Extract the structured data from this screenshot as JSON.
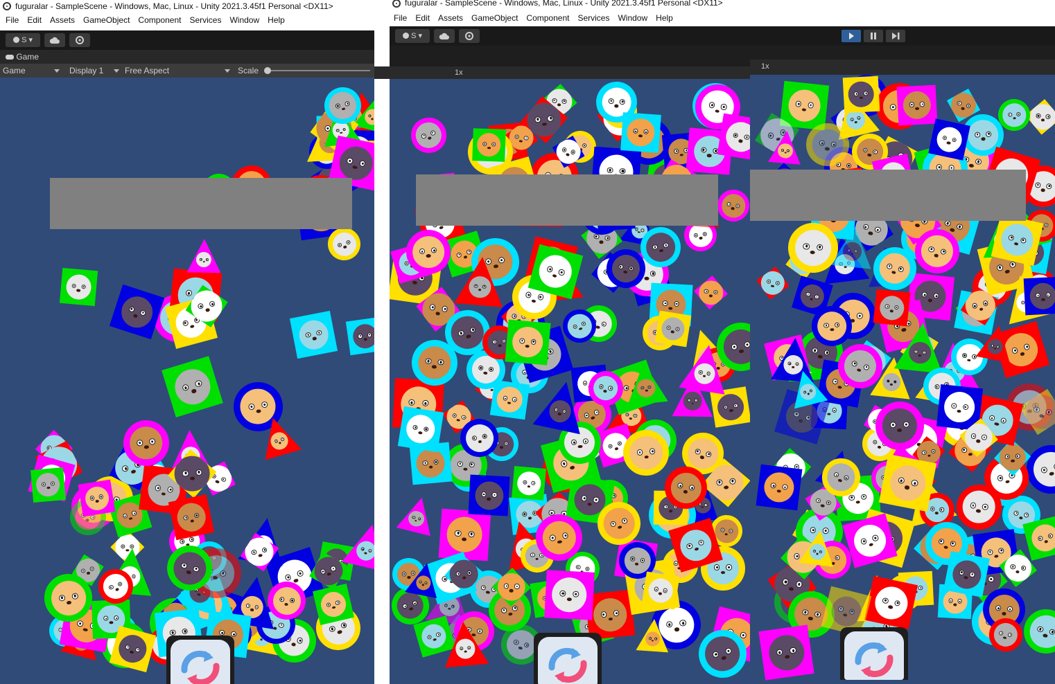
{
  "windows": [
    {
      "id": "left",
      "title": "fuguralar - SampleScene - Windows, Mac, Linux - Unity 2021.3.45f1 Personal <DX11>",
      "menu": [
        "File",
        "Edit",
        "Assets",
        "GameObject",
        "Component",
        "Services",
        "Window",
        "Help"
      ],
      "account_label": "S",
      "tab_label": "Game",
      "gamebar": {
        "mode": "Game",
        "display": "Display 1",
        "aspect": "Free Aspect",
        "scale_label": "Scale"
      }
    },
    {
      "id": "middle",
      "title": "fuguralar - SampleScene - Windows, Mac, Linux - Unity 2021.3.45f1 Personal <DX11>",
      "menu": [
        "File",
        "Edit",
        "Assets",
        "GameObject",
        "Component",
        "Services",
        "Window",
        "Help"
      ],
      "account_label": "S",
      "scale_value": "1x"
    },
    {
      "id": "right",
      "scale_value": "1x"
    }
  ],
  "play_controls": [
    "play-icon",
    "pause-icon",
    "step-icon"
  ],
  "colors": {
    "game_bg": "#304b78",
    "tile_colors": [
      "#ff0000",
      "#00e000",
      "#0000e0",
      "#ffe000",
      "#ff00ff",
      "#00e0ff"
    ],
    "gray_band": "#808080",
    "editor_dark": "#191919",
    "play_active": "#2f5f9a"
  },
  "icons": {
    "refresh": "refresh-icon",
    "cloud": "cloud-icon",
    "settings": "settings-icon",
    "unity": "unity-logo-icon",
    "animal": "animal-face-icon"
  }
}
